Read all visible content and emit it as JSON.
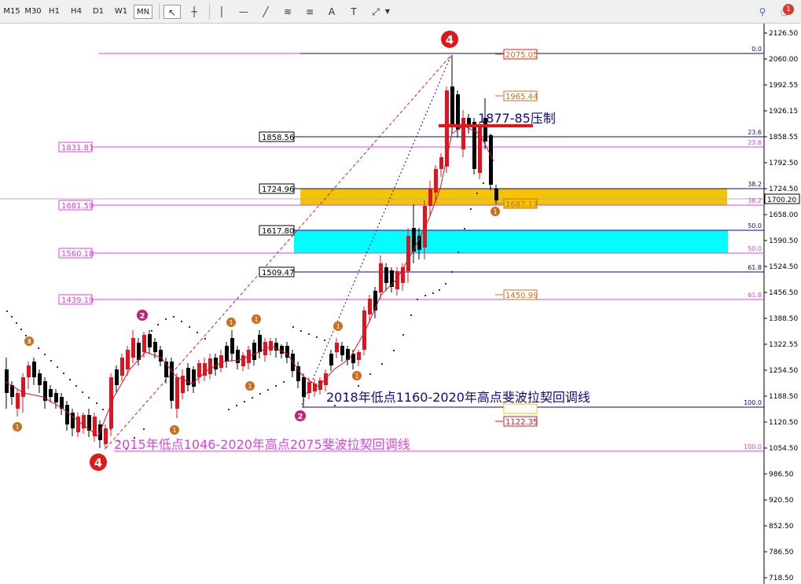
{
  "toolbar": {
    "timeframes": [
      "M15",
      "M30",
      "H1",
      "H4",
      "D1",
      "W1",
      "MN"
    ],
    "active_timeframe": "MN",
    "tools": [
      {
        "icon": "cursor-icon",
        "label": "↖"
      },
      {
        "icon": "crosshair-icon",
        "label": "┼"
      },
      {
        "icon": "vertical-line-icon",
        "label": "│"
      },
      {
        "icon": "horizontal-line-icon",
        "label": "—"
      },
      {
        "icon": "trendline-icon",
        "label": "╱"
      },
      {
        "icon": "equidistant-channel-icon",
        "label": "≋"
      },
      {
        "icon": "fibonacci-icon",
        "label": "≡"
      },
      {
        "icon": "text-icon",
        "label": "A"
      },
      {
        "icon": "text-label-icon",
        "label": "T"
      },
      {
        "icon": "shapes-icon",
        "label": "⤢"
      }
    ],
    "search_icon": "search-icon",
    "notifications_count": "1"
  },
  "price_axis": {
    "ticks": [
      "2126.50",
      "2060.00",
      "1992.55",
      "1926.15",
      "1858.55",
      "1792.50",
      "1724.50",
      "1658.00",
      "1590.50",
      "1524.50",
      "1456.50",
      "1388.50",
      "1322.55",
      "1254.50",
      "1188.50",
      "1120.50",
      "1054.50",
      "986.50",
      "920.50",
      "852.50",
      "786.50",
      "718.50"
    ],
    "current_price": "1700.20"
  },
  "levels": {
    "left_pink": [
      "1831.81",
      "1681.59",
      "1560.18",
      "1439.19"
    ],
    "left_black": [
      "1858.56",
      "1724.96",
      "1617.80",
      "1509.47"
    ],
    "right_labels": [
      "2075.05",
      "1965.44",
      "1687.17",
      "1450.99",
      "1122.35"
    ],
    "fib_black": [
      "0.0",
      "23.6",
      "38.2",
      "50.0",
      "61.8",
      "100.0"
    ],
    "fib_pink": [
      "23.6",
      "38.2",
      "50.0",
      "61.8",
      "100.0"
    ]
  },
  "annotations": {
    "resistance": "1877-85压制",
    "fib_2018": "2018年低点1160-2020年高点斐波拉契回调线",
    "fib_2015": "2015年低点1046-2020年高点2075斐波拉契回调线",
    "wave4_top": "4",
    "wave4_bottom": "4",
    "wave2_a": "2",
    "wave2_b": "2",
    "small_1": "1",
    "small_3": "3"
  },
  "colors": {
    "bull": "#e0141e",
    "bear": "#000000",
    "pink": "#e040e0",
    "navy": "#0a0a8a",
    "gold": "#f5c400",
    "cyan": "#00ffff",
    "orange": "#c87020",
    "wave_red": "#e01818",
    "wave_purple": "#c0207a"
  }
}
